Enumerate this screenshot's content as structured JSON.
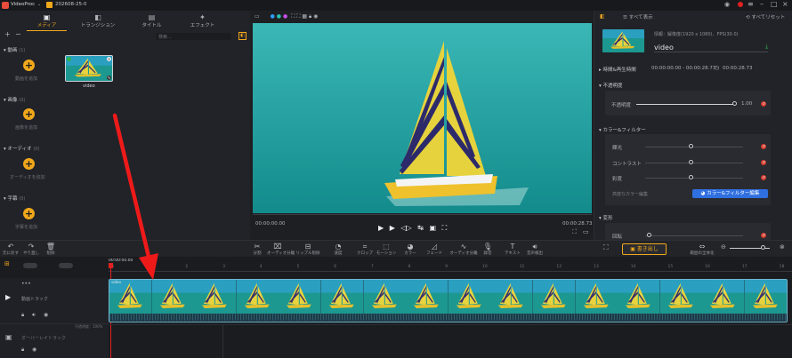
{
  "titlebar": {
    "app": "VideoProc",
    "project": "202608-25-0"
  },
  "media_tabs": [
    {
      "label": "メディア"
    },
    {
      "label": "トランジション"
    },
    {
      "label": "タイトル"
    },
    {
      "label": "エフェクト"
    }
  ],
  "media": {
    "search_placeholder": "検索...",
    "sections": [
      {
        "title": "動画",
        "count": "(1)",
        "add_label": "動画を追加"
      },
      {
        "title": "画像",
        "count": "(0)",
        "add_label": "画像を追加"
      },
      {
        "title": "オーディオ",
        "count": "(0)",
        "add_label": "オーディオを追加"
      },
      {
        "title": "字幕",
        "count": "(0)",
        "add_label": "字幕を追加"
      }
    ],
    "clip_name": "video"
  },
  "preview": {
    "time_current": "00:00:00.00",
    "time_total": "00:00:28.73"
  },
  "props": {
    "show_all": "すべて表示",
    "apply_all": "すべてリセット",
    "info": "情報：解像度(1920 x 1080)、FPS(30.0)",
    "clip_name": "video",
    "duration_title": "時間&再生時間",
    "start": "00:00:00.00 - 00:00:28.73",
    "duration": "00:00:28.73",
    "opacity_title": "不透明度",
    "opacity_label": "不透明度",
    "opacity_value": "1.00",
    "color_title": "カラー&フィルター",
    "brightness": "輝光",
    "contrast": "コントラスト",
    "saturation": "彩度",
    "advanced": "高度なカラー編集",
    "color_button": "カラー&フィルター編集",
    "transform_title": "変形",
    "rotate": "回転"
  },
  "toolbar": {
    "left": [
      "元に戻す",
      "やり直し",
      "削除"
    ],
    "center": [
      "分割",
      "オーディオ分離",
      "リップル削除",
      "速度",
      "クロップ",
      "モーション",
      "カラー",
      "フェード",
      "オーディオ分離",
      "録音",
      "テキスト",
      "音声検出"
    ],
    "export_label": "書き出し",
    "fit_label": "範囲の全体化"
  },
  "timeline": {
    "playhead_time": "00:00:00.00",
    "ruler": [
      "0",
      "1",
      "2",
      "3",
      "4",
      "5",
      "6",
      "7",
      "8",
      "9",
      "10",
      "11",
      "12",
      "13",
      "14",
      "15",
      "16",
      "17",
      "18"
    ],
    "tracks": [
      {
        "label": "動画トラック"
      },
      {
        "label": "オーバーレイトラック"
      }
    ],
    "clip_name": "video",
    "overlay_badge": "不透明度：100%"
  },
  "colors": {
    "accent": "#f0a81b",
    "playhead": "#e02020",
    "blue": "#2f6fe0",
    "arrow": "#ee1a1a",
    "sea": "#1e9a9a",
    "sky": "#3d99c4"
  }
}
